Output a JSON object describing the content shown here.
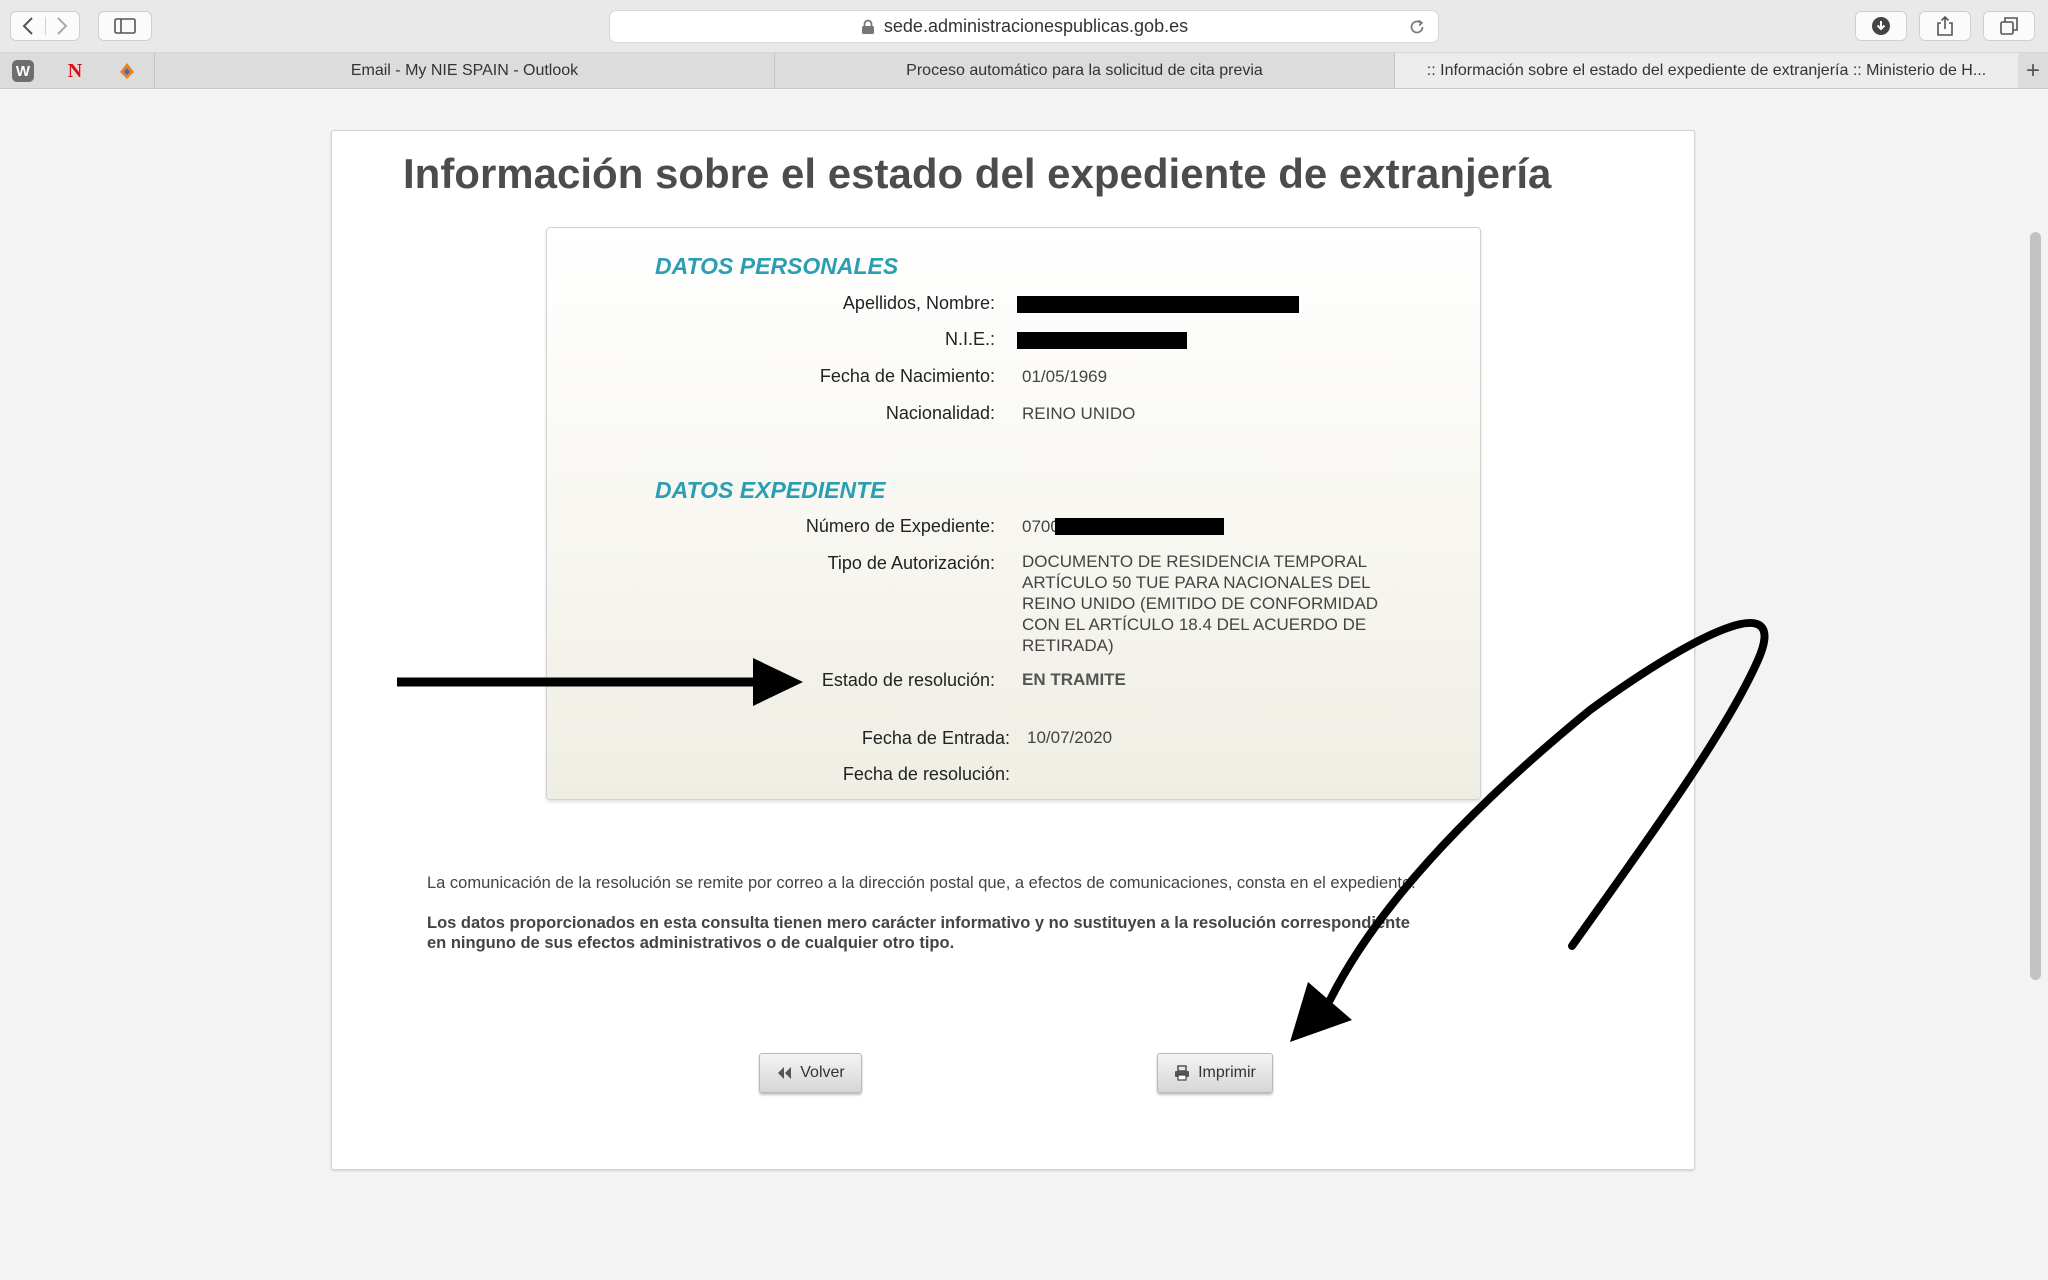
{
  "browser": {
    "url": "sede.administracionespublicas.gob.es",
    "tabs": [
      {
        "label": "Email - My NIE SPAIN - Outlook"
      },
      {
        "label": "Proceso automático para la solicitud de cita previa"
      },
      {
        "label": ":: Información sobre el estado del expediente de extranjería :: Ministerio de H..."
      }
    ],
    "favicons": [
      {
        "label": "W",
        "color": "#6e6e6e"
      },
      {
        "label": "N",
        "color": "#e50914"
      }
    ]
  },
  "page": {
    "title": "Información sobre el estado del expediente de extranjería"
  },
  "personal": {
    "heading": "DATOS PERSONALES",
    "name_label": "Apellidos, Nombre:",
    "nie_label": "N.I.E.:",
    "birth_label": "Fecha de Nacimiento:",
    "birth_value": "01/05/1969",
    "nationality_label": "Nacionalidad:",
    "nationality_value": "REINO UNIDO"
  },
  "file": {
    "heading": "DATOS EXPEDIENTE",
    "number_label": "Número de Expediente:",
    "number_value": "0700",
    "type_label": "Tipo de Autorización:",
    "type_value": "DOCUMENTO DE RESIDENCIA TEMPORAL ARTÍCULO 50 TUE PARA NACIONALES DEL REINO UNIDO (EMITIDO DE CONFORMIDAD CON EL ARTÍCULO 18.4 DEL ACUERDO DE RETIRADA)",
    "status_label": "Estado de resolución:",
    "status_value": "EN TRAMITE",
    "entry_label": "Fecha de Entrada:",
    "entry_value": "10/07/2020",
    "resolution_label": "Fecha de resolución:",
    "resolution_value": ""
  },
  "notes": {
    "communication": "La comunicación de la resolución se remite por correo a la dirección postal que, a efectos de comunicaciones, consta en el expediente.",
    "disclaimer_line1": "Los datos proporcionados en esta consulta tienen mero carácter informativo y no sustituyen a la resolución correspondiente",
    "disclaimer_line2": "en ninguno de sus efectos administrativos o de cualquier otro tipo."
  },
  "buttons": {
    "back": "Volver",
    "print": "Imprimir"
  },
  "colors": {
    "section_heading": "#2b9eb3",
    "annotation": "#000000"
  }
}
